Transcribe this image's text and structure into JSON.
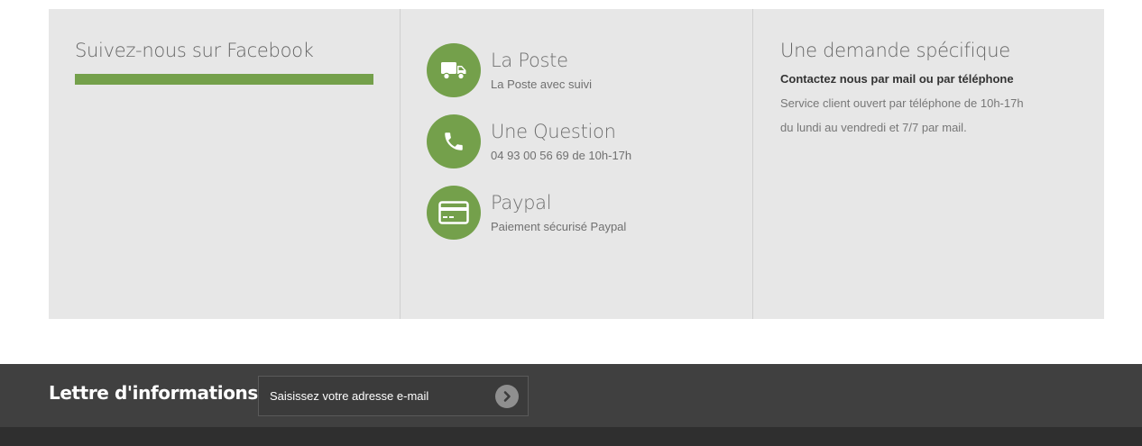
{
  "facebook": {
    "title": "Suivez-nous sur Facebook",
    "bar_color": "#74a04b"
  },
  "features": [
    {
      "icon": "truck-icon",
      "title": "La Poste",
      "subtitle": "La Poste avec suivi"
    },
    {
      "icon": "phone-icon",
      "title": "Une Question",
      "subtitle": "04 93 00 56 69 de 10h-17h"
    },
    {
      "icon": "credit-card-icon",
      "title": "Paypal",
      "subtitle": "Paiement sécurisé Paypal"
    }
  ],
  "request": {
    "title": "Une demande spécifique",
    "contact": "Contactez nous par mail ou par téléphone",
    "line1": "Service client ouvert par téléphone de 10h-17h",
    "line2": "du lundi au vendredi et 7/7 par mail."
  },
  "newsletter": {
    "title": "Lettre d'informations",
    "placeholder": "Saisissez votre adresse e-mail",
    "submit_icon": "arrow-right-circle-icon"
  },
  "colors": {
    "accent": "#74a04b",
    "panel": "#e7e7e7",
    "newsletter_bg": "#404040",
    "footer_bg": "#2f2f2f"
  }
}
